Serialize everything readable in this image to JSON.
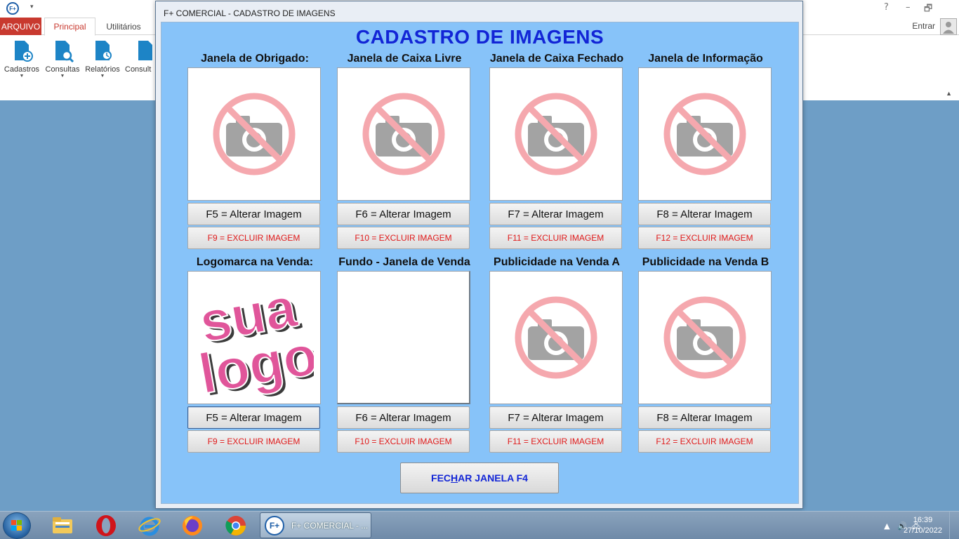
{
  "app": {
    "logo_text": "F+",
    "tabs": {
      "arquivo": "ARQUIVO",
      "principal": "Principal",
      "utilitarios": "Utilitários"
    },
    "user_button": "Entrar",
    "window_controls": {
      "help": "?",
      "minimize": "–",
      "restore": "🗗"
    },
    "ribbon": [
      {
        "label": "Cadastros",
        "icon": "cadastros-icon"
      },
      {
        "label": "Consultas",
        "icon": "consultas-icon"
      },
      {
        "label": "Relatórios",
        "icon": "relatorios-icon"
      },
      {
        "label": "Consult",
        "icon": "consultas-icon"
      }
    ]
  },
  "dialog": {
    "title": "F+ COMERCIAL - CADASTRO DE IMAGENS",
    "heading": "CADASTRO DE IMAGENS",
    "slots": [
      {
        "title": "Janela de Obrigado:",
        "image": "no-photo",
        "alter": "F5 = Alterar Imagem",
        "excluir": "F9 = EXCLUIR IMAGEM"
      },
      {
        "title": "Janela de Caixa Livre",
        "image": "no-photo",
        "alter": "F6 = Alterar Imagem",
        "excluir": "F10 = EXCLUIR IMAGEM"
      },
      {
        "title": "Janela de Caixa Fechado",
        "image": "no-photo",
        "alter": "F7 = Alterar Imagem",
        "excluir": "F11 = EXCLUIR IMAGEM"
      },
      {
        "title": "Janela de Informação",
        "image": "no-photo",
        "alter": "F8 = Alterar Imagem",
        "excluir": "F12 = EXCLUIR IMAGEM"
      },
      {
        "title": "Logomarca na Venda:",
        "image": "sua-logo",
        "alter": "F5 = Alterar Imagem",
        "excluir": "F9 = EXCLUIR IMAGEM"
      },
      {
        "title": "Fundo - Janela de Venda",
        "image": "empty",
        "alter": "F6 = Alterar Imagem",
        "excluir": "F10 = EXCLUIR IMAGEM"
      },
      {
        "title": "Publicidade na Venda A",
        "image": "no-photo",
        "alter": "F7 = Alterar Imagem",
        "excluir": "F11 = EXCLUIR IMAGEM"
      },
      {
        "title": "Publicidade na Venda B",
        "image": "no-photo",
        "alter": "F8 = Alterar Imagem",
        "excluir": "F12 = EXCLUIR IMAGEM"
      }
    ],
    "logo_text": {
      "line1": "sua",
      "line2": "logo"
    },
    "close_button": {
      "before": "FEC",
      "underlined": "H",
      "after": "AR JANELA F4"
    }
  },
  "taskbar": {
    "task_label": "F+ COMERCIAL - ...",
    "task_icon_text": "F+",
    "apps": [
      "explorer-icon",
      "opera-icon",
      "ie-icon",
      "firefox-icon",
      "chrome-icon"
    ],
    "time": "16:39",
    "date": "27/10/2022"
  },
  "colors": {
    "content_bg": "#87c3f9",
    "heading": "#1225d6",
    "excluir_text": "#e01a1a",
    "arquivo_tab": "#c8392f"
  }
}
